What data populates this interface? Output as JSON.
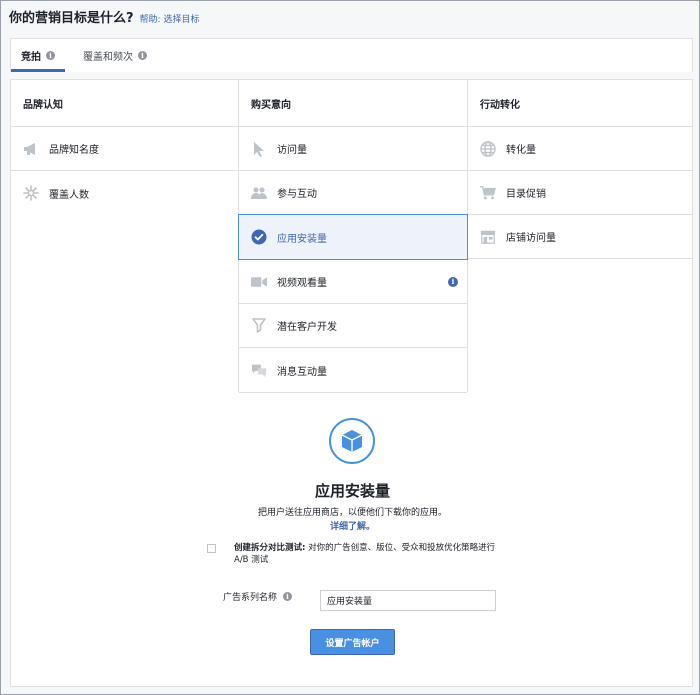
{
  "header": {
    "title": "你的营销目标是什么?",
    "help_link": "帮助: 选择目标"
  },
  "tabs": [
    {
      "label": "竞拍",
      "active": true
    },
    {
      "label": "覆盖和频次",
      "active": false
    }
  ],
  "columns": [
    {
      "heading": "品牌认知",
      "items": [
        {
          "label": "品牌知名度",
          "icon": "megaphone-icon"
        },
        {
          "label": "覆盖人数",
          "icon": "reach-burst-icon"
        }
      ]
    },
    {
      "heading": "购买意向",
      "items": [
        {
          "label": "访问量",
          "icon": "cursor-icon"
        },
        {
          "label": "参与互动",
          "icon": "people-icon"
        },
        {
          "label": "应用安装量",
          "icon": "check-circle-icon",
          "selected": true
        },
        {
          "label": "视频观看量",
          "icon": "video-camera-icon",
          "info": true
        },
        {
          "label": "潜在客户开发",
          "icon": "funnel-icon"
        },
        {
          "label": "消息互动量",
          "icon": "chat-bubbles-icon"
        }
      ]
    },
    {
      "heading": "行动转化",
      "items": [
        {
          "label": "转化量",
          "icon": "globe-icon"
        },
        {
          "label": "目录促销",
          "icon": "shopping-cart-icon"
        },
        {
          "label": "店铺访问量",
          "icon": "store-icon"
        }
      ]
    }
  ],
  "detail": {
    "icon": "cube-box-icon",
    "title": "应用安装量",
    "description": "把用户送往应用商店，以便他们下载你的应用。",
    "learn_more": "详细了解。",
    "split_test_label": "创建拆分对比测试:",
    "split_test_text": "对你的广告创意、版位、受众和投放优化策略进行 A/B 测试",
    "split_test_checked": false,
    "campaign_name_label": "广告系列名称",
    "campaign_name_value": "应用安装量",
    "submit_label": "设置广告帐户"
  },
  "colors": {
    "accent": "#4267b2",
    "selection_border": "#4a90e2",
    "selection_bg": "#eef3fb",
    "icon_gray": "#bec3c9"
  }
}
